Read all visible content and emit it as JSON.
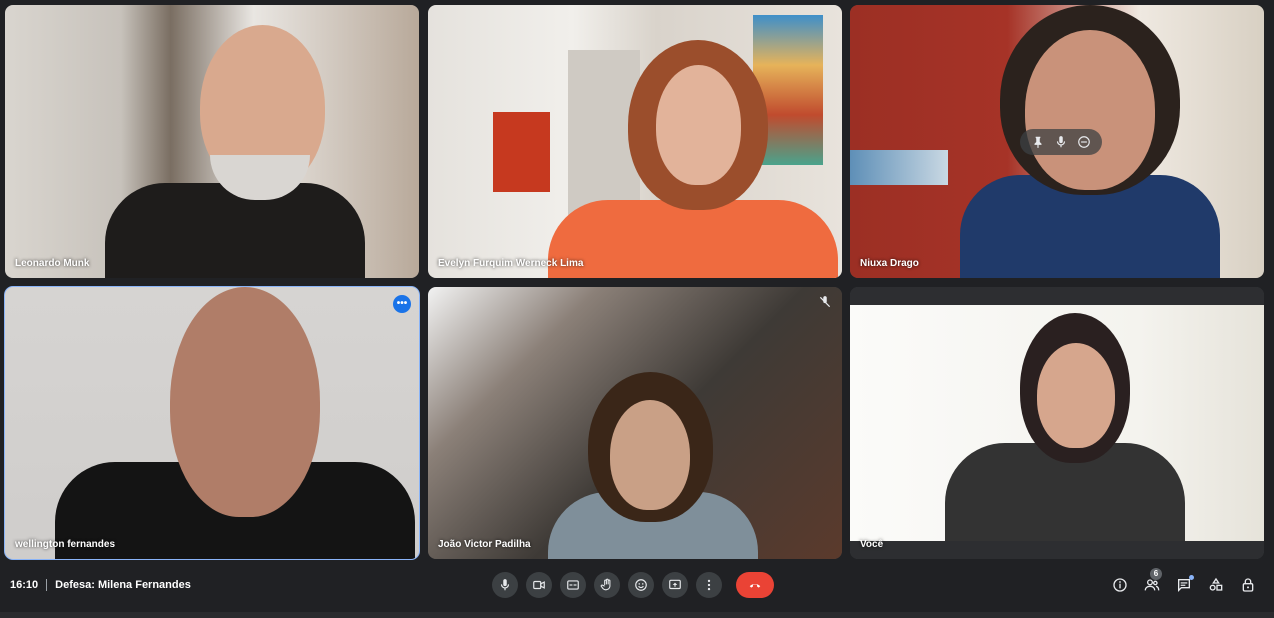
{
  "participants": [
    {
      "name": "Leonardo Munk"
    },
    {
      "name": "Evelyn Furquim Werneck Lima"
    },
    {
      "name": "Niuxa Drago"
    },
    {
      "name": "wellington fernandes"
    },
    {
      "name": "João Victor Padilha"
    },
    {
      "name": "Você"
    }
  ],
  "meeting": {
    "time": "16:10",
    "title": "Defesa: Milena Fernandes"
  },
  "people_count": "6",
  "more_options_glyph": "•••",
  "icons": {
    "mic": "microphone-icon",
    "camera": "camera-icon",
    "captions": "captions-icon",
    "hand": "raise-hand-icon",
    "emoji": "emoji-icon",
    "present": "present-screen-icon",
    "more": "more-vert-icon",
    "end": "end-call-icon",
    "info": "info-icon",
    "people": "people-icon",
    "chat": "chat-icon",
    "activities": "activities-icon",
    "lock": "host-controls-icon",
    "pin": "pin-icon",
    "mute": "mute-icon",
    "remove": "remove-icon",
    "muted": "muted-mic-icon"
  },
  "colors": {
    "background": "#202124",
    "control_bg": "#3c4043",
    "end_call": "#ea4335",
    "active_speaker": "#8ab4f8",
    "more_button": "#1a73e8"
  }
}
